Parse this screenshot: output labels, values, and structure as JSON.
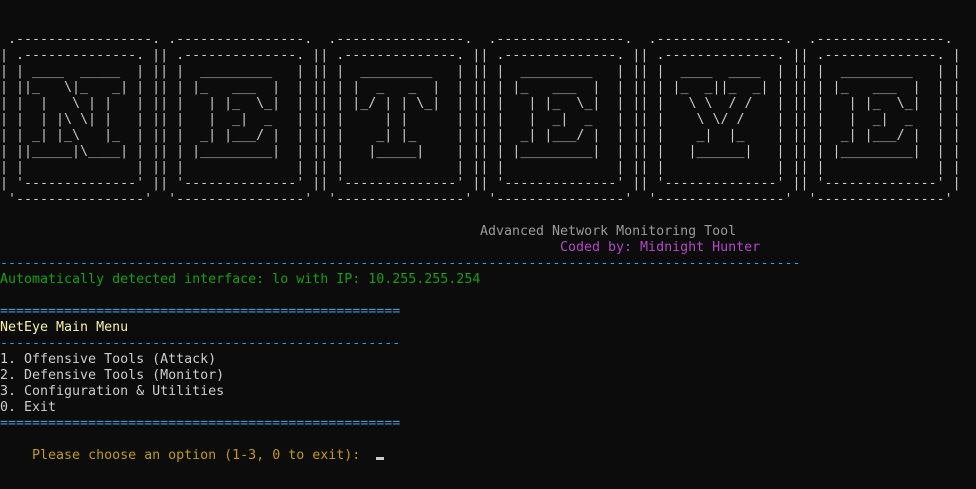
{
  "banner": {
    "ascii_lines": [
      " .-----------------. .----------------.  .----------------.  .----------------.  .----------------.  .----------------. ",
      "| .--------------. || .--------------. || .--------------. || .--------------. || .--------------. || .--------------. |",
      "| | ____  _____  | || |  _________   | || |  _________   | || |  _________   | || |  ____  ____  | || |  _________   | |",
      "| ||_   \\|_   _| | || | |_   ___  |  | || | |  _   _  |  | || | |_   ___  |  | || | |_  _||_  _| | || | |_   ___  |  | |",
      "| |  |   \\ | |   | || |   | |_  \\_|  | || | |_/ | | \\_|  | || |   | |_  \\_|  | || |   \\ \\  / /   | || |   | |_  \\_|  | |",
      "| |  | |\\ \\| |   | || |   |  _|  _   | || |     | |      | || |   |  _|  _   | || |    \\ \\/ /    | || |   |  _|  _   | |",
      "| | _| |_\\   |_  | || |  _| |___/ |  | || |    _| |_     | || |  _| |___/ |  | || |    _|  |_    | || |  _| |___/ |  | |",
      "| ||_____|\\____| | || | |_________|  | || |   |_____|    | || | |_________|  | || |   |______|   | || | |_________|  | |",
      "| |              | || |              | || |              | || |              | || |              | || |              | |",
      "| '--------------' || '--------------' || '--------------' || '--------------' || '--------------' || '--------------' |",
      " '----------------'  '----------------'  '----------------'  '----------------'  '----------------'  '----------------' "
    ]
  },
  "header": {
    "subtitle": "Advanced Network Monitoring Tool",
    "credit": "Coded by: Midnight Hunter"
  },
  "separators": {
    "dash_long": "----------------------------------------------------------------------------------------------------",
    "equals": "==================================================",
    "dash_short": "--------------------------------------------------"
  },
  "status": {
    "detected_interface": "Automatically detected interface: lo with IP: 10.255.255.254"
  },
  "menu": {
    "title": "NetEye Main Menu",
    "items": [
      "1. Offensive Tools (Attack)",
      "2. Defensive Tools (Monitor)",
      "3. Configuration & Utilities",
      "0. Exit"
    ],
    "prompt": "Please choose an option (1-3, 0 to exit): "
  },
  "colors": {
    "background": "#0c0c0c",
    "separator_blue": "#3a96dd",
    "status_green": "#13a10e",
    "title_yellow": "#f9f1a5",
    "prompt_gold": "#c19c00",
    "credit_purple": "#b148c6"
  }
}
